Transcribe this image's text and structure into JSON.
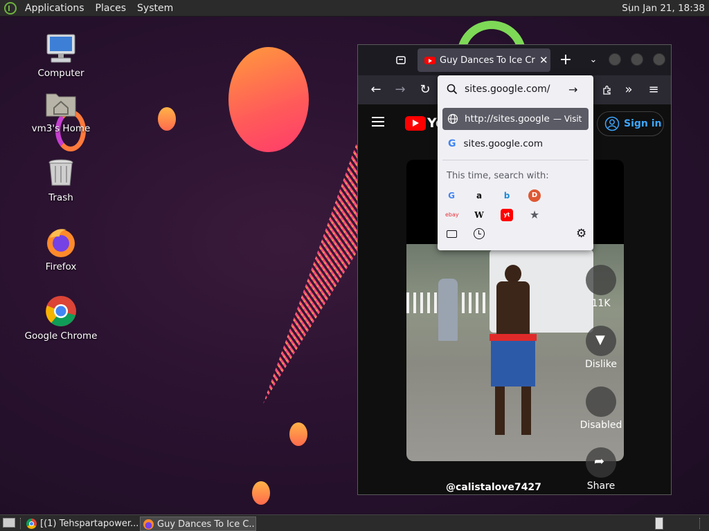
{
  "top_panel": {
    "menus": [
      "Applications",
      "Places",
      "System"
    ],
    "clock": "Sun Jan 21, 18:38"
  },
  "desktop": {
    "icons": [
      {
        "label": "Computer",
        "icon": "computer-icon"
      },
      {
        "label": "vm3's Home",
        "icon": "home-folder-icon"
      },
      {
        "label": "Trash",
        "icon": "trash-icon"
      },
      {
        "label": "Firefox",
        "icon": "firefox-icon"
      },
      {
        "label": "Google Chrome",
        "icon": "chrome-icon"
      }
    ]
  },
  "browser": {
    "tab_title": "Guy Dances To Ice Crea",
    "url_value": "sites.google.com/",
    "suggestions": {
      "visit_url": "http://sites.google.",
      "visit_label": "— Visit",
      "search_suggestion": "sites.google.com",
      "search_with_label": "This time, search with:",
      "engines": [
        "G",
        "a",
        "b",
        "D",
        "ebay",
        "W",
        "yt",
        "★"
      ]
    },
    "page": {
      "logo_text": "You",
      "sign_in": "Sign in",
      "like_count": "11K",
      "dislike_label": "Dislike",
      "disabled_label": "Disabled",
      "share_label": "Share",
      "channel": "@calistalove7427"
    }
  },
  "taskbar": {
    "tasks": [
      {
        "label": "[(1) Tehspartapower...",
        "icon": "chrome-icon"
      },
      {
        "label": "Guy Dances To Ice C...",
        "icon": "firefox-icon"
      }
    ]
  },
  "colors": {
    "accent": "#0060df",
    "youtube_red": "#ff0000",
    "sign_in_blue": "#3ea6ff"
  }
}
